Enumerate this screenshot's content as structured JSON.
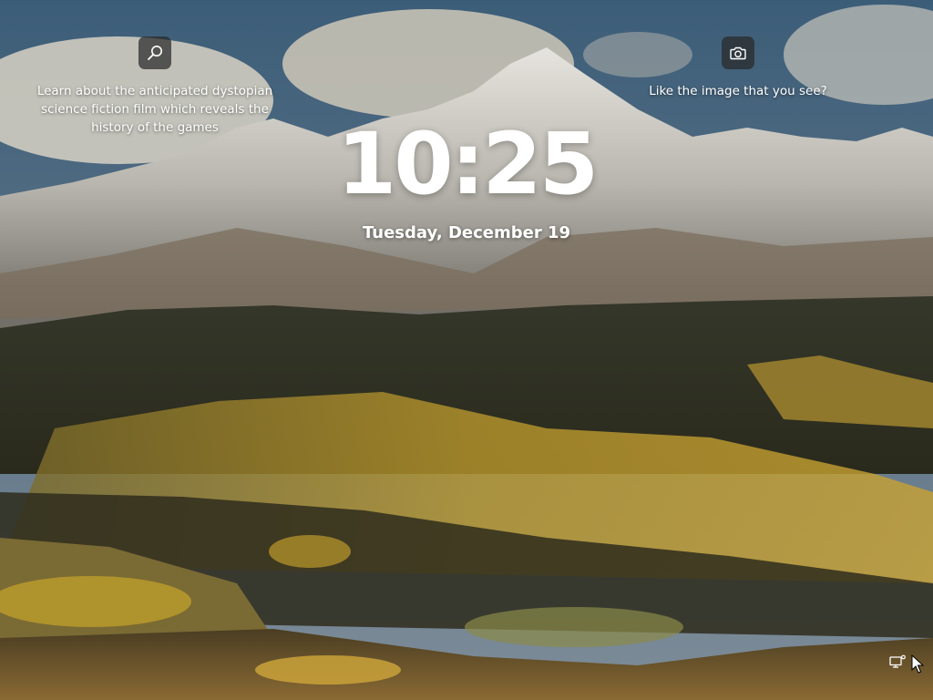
{
  "lockscreen": {
    "time": "10:25",
    "date": "Tuesday, December 19",
    "spotlight_left": {
      "icon": "search-icon",
      "text": "Learn about the anticipated dystopian science fiction film which reveals the history of the games"
    },
    "spotlight_right": {
      "icon": "camera-icon",
      "text": "Like the image that you see?"
    },
    "tray": {
      "icon": "network-icon"
    },
    "colors": {
      "text": "#ffffff",
      "icon_button_bg": "#282828"
    }
  }
}
